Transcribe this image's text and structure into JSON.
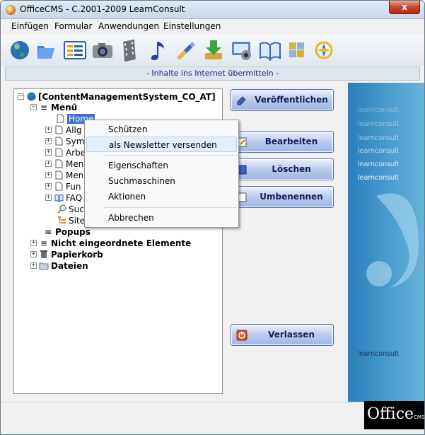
{
  "window": {
    "title": "OfficeCMS - C.2001-2009 LearnConsult",
    "close_glyph": "x"
  },
  "menubar": {
    "items": [
      "Einfügen",
      "Formular",
      "Anwendungen",
      "Einstellungen"
    ]
  },
  "toolbar": {
    "icons": [
      "globe-icon",
      "folder-icon",
      "form-icon",
      "camera-icon",
      "film-icon",
      "music-note-icon",
      "brush-icon",
      "download-icon",
      "screen-icon",
      "book-icon",
      "puzzle-icon",
      "compass-icon"
    ]
  },
  "hint": "- Inhalte ins Internet übermitteln -",
  "tree": {
    "root": "[ContentManagementSystem_CO_AT]",
    "menu": "Menü",
    "home": "Home",
    "children": [
      "Allg",
      "Sym",
      "Arbe",
      "Men",
      "Men",
      "Fun",
      "FAQ",
      "Suc",
      "Site"
    ],
    "popups": "Popups",
    "unsorted": "Nicht eingeordnete Elemente",
    "trash": "Papierkorb",
    "files": "Dateien"
  },
  "buttons": {
    "publish": "Veröffentlichen",
    "edit": "Bearbeiten",
    "delete": "Löschen",
    "rename": "Umbenennen",
    "exit": "Verlassen"
  },
  "context_menu": {
    "protect": "Schützen",
    "newsletter": "als Newsletter versenden",
    "properties": "Eigenschaften",
    "search_engines": "Suchmaschinen",
    "actions": "Aktionen",
    "cancel": "Abbrechen"
  },
  "brand": {
    "tagline": "learnconsult",
    "logo_main": "Office",
    "logo_sub": "CMS"
  },
  "colors": {
    "accent": "#1b1b5e",
    "panel": "#3a8fc4"
  }
}
